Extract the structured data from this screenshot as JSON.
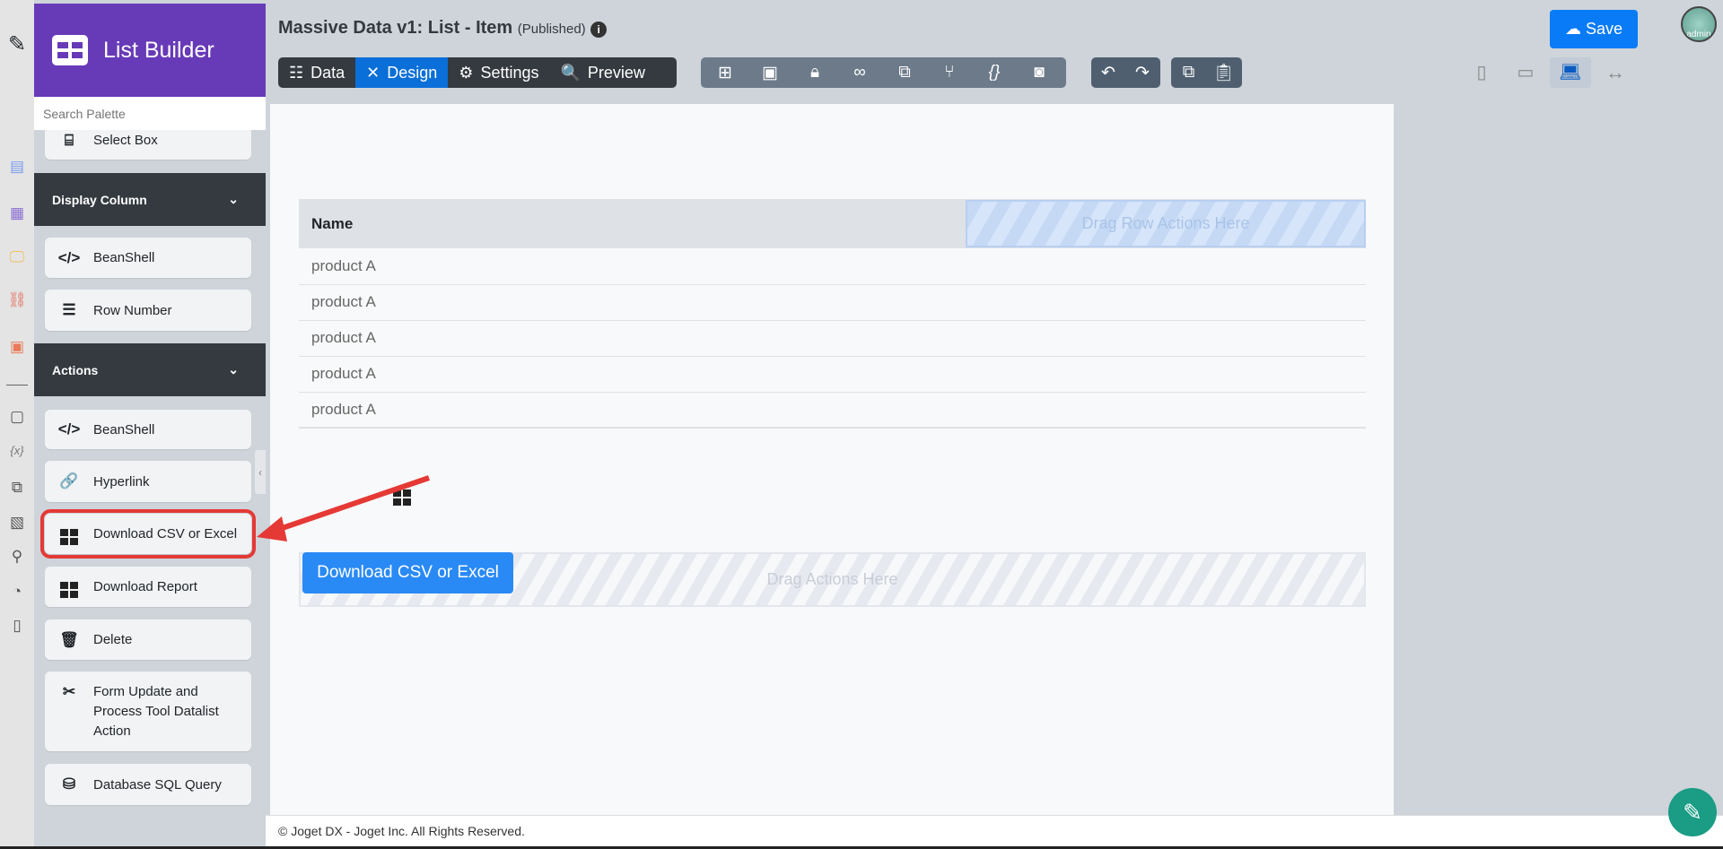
{
  "app": {
    "name": "List Builder",
    "search_placeholder": "Search Palette"
  },
  "header": {
    "title": "Massive Data v1: List - Item",
    "status": "(Published)",
    "save_label": "Save",
    "avatar_label": "admin"
  },
  "toolbar": {
    "tabs": [
      {
        "label": "Data"
      },
      {
        "label": "Design",
        "active": true
      },
      {
        "label": "Settings"
      },
      {
        "label": "Preview"
      }
    ],
    "tools": [
      "sitemap-icon",
      "form-icon",
      "lock-icon",
      "binoculars-icon",
      "translate-icon",
      "branch-icon",
      "braces-icon",
      "camera-icon"
    ],
    "active_device": "laptop"
  },
  "palette": {
    "top_item": "Select Box",
    "sections": [
      {
        "title": "Display Column",
        "items": [
          "BeanShell",
          "Row Number"
        ]
      },
      {
        "title": "Actions",
        "items": [
          "BeanShell",
          "Hyperlink",
          "Download CSV or Excel",
          "Download Report",
          "Delete",
          "Form Update and Process Tool Datalist Action",
          "Database SQL Query"
        ]
      }
    ],
    "highlighted": "Download CSV or Excel"
  },
  "table": {
    "header": "Name",
    "row_drop": "Drag Row Actions Here",
    "rows": [
      "product A",
      "product A",
      "product A",
      "product A",
      "product A"
    ]
  },
  "actions": {
    "button": "Download CSV or Excel",
    "drop": "Drag Actions Here"
  },
  "footer": "© Joget DX - Joget Inc. All Rights Reserved.",
  "colors": {
    "brand": "#673ab7",
    "primary": "#007bff",
    "annotation": "#e53935"
  }
}
